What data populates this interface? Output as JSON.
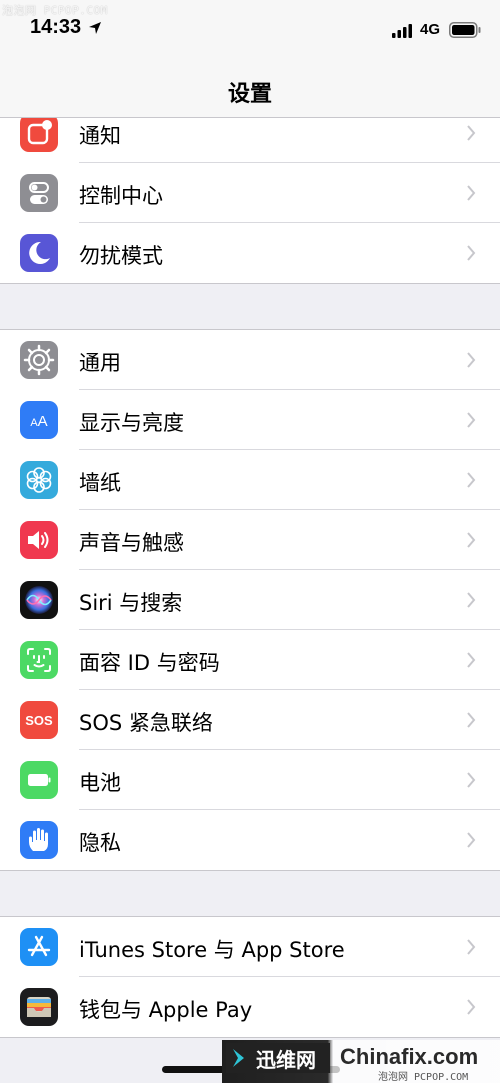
{
  "status_bar": {
    "watermark": "泡泡网 PCPOP.COM",
    "time": "14:33",
    "network": "4G"
  },
  "nav": {
    "title": "设置"
  },
  "groups": [
    {
      "items": [
        {
          "label": "通知",
          "icon": "notifications-icon",
          "color": "#f04a3e"
        },
        {
          "label": "控制中心",
          "icon": "control-center-icon",
          "color": "#8e8e93"
        },
        {
          "label": "勿扰模式",
          "icon": "do-not-disturb-moon-icon",
          "color": "#5856d6"
        }
      ]
    },
    {
      "items": [
        {
          "label": "通用",
          "icon": "gear-icon",
          "color": "#8e8e93"
        },
        {
          "label": "显示与亮度",
          "icon": "display-brightness-icon",
          "color": "#2f7cf6",
          "glyph": "AA"
        },
        {
          "label": "墙纸",
          "icon": "wallpaper-flower-icon",
          "color": "#35aadc"
        },
        {
          "label": "声音与触感",
          "icon": "speaker-icon",
          "color": "#f0384f"
        },
        {
          "label": "Siri 与搜索",
          "icon": "siri-icon",
          "color": "#1a1a2e"
        },
        {
          "label": "面容 ID 与密码",
          "icon": "face-id-icon",
          "color": "#4cd964"
        },
        {
          "label": "SOS 紧急联络",
          "icon": "sos-icon",
          "color": "#f04a3e",
          "glyph": "SOS"
        },
        {
          "label": "电池",
          "icon": "battery-icon",
          "color": "#4cd964"
        },
        {
          "label": "隐私",
          "icon": "privacy-hand-icon",
          "color": "#2f7cf6"
        }
      ]
    },
    {
      "items": [
        {
          "label": "iTunes Store 与 App Store",
          "icon": "app-store-icon",
          "color": "#1e90f5"
        },
        {
          "label": "钱包与 Apple Pay",
          "icon": "wallet-icon",
          "color": "#1c1c1e"
        }
      ]
    }
  ],
  "watermark_bottom": {
    "brand_cn": "迅维网",
    "brand_en": "Chinafix.com",
    "small": "泡泡网 PCPOP.COM"
  }
}
